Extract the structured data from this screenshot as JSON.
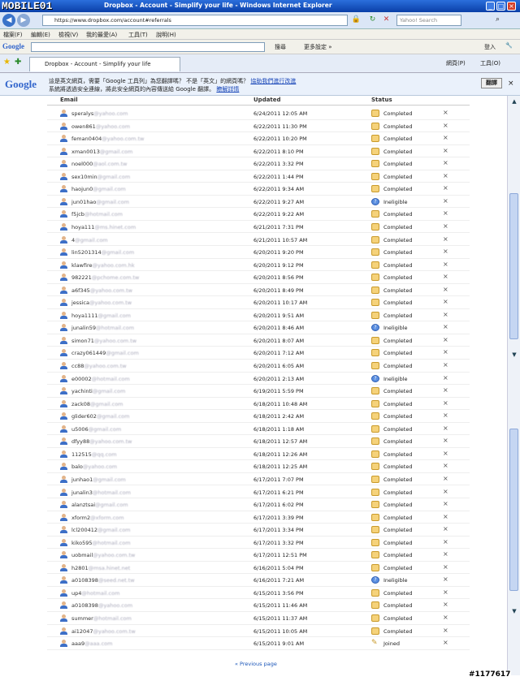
{
  "window": {
    "logo": "MOBILE01",
    "title": "Dropbox - Account - Simplify your life - Windows Internet Explorer",
    "address": "https://www.dropbox.com/account#referrals",
    "search_placeholder": "Yahoo! Search"
  },
  "menu": [
    "檔案(F)",
    "編輯(E)",
    "檢視(V)",
    "我的最愛(A)",
    "工具(T)",
    "說明(H)"
  ],
  "google_toolbar": {
    "logo": "Google",
    "search_label": "搜尋",
    "more_label": "更多設定 »",
    "login_label": "登入"
  },
  "favorites": {
    "tab_title": "Dropbox - Account - Simplify your life",
    "page_label": "網頁(P)",
    "tools_label": "工具(O)"
  },
  "translate_bar": {
    "logo": "Google",
    "message1": "這是英文網頁，需要「Google 工具列」為您翻譯嗎？ 不是「英文」的網頁嗎？",
    "report_link": "協助我們進行改進",
    "message2": "系統將透過安全連線，將此安全網頁的內容傳送給 Google 翻譯。",
    "learn_more": "瞭解詳情",
    "translate_button": "翻譯"
  },
  "table": {
    "headers": {
      "email": "Email",
      "updated": "Updated",
      "status": "Status"
    },
    "rows": [
      {
        "email": "speralys",
        "domain": "@yahoo.com",
        "updated": "6/24/2011 12:05 AM",
        "status": "Completed"
      },
      {
        "email": "owen861",
        "domain": "@yahoo.com",
        "updated": "6/22/2011 11:30 PM",
        "status": "Completed"
      },
      {
        "email": "feman0404",
        "domain": "@yahoo.com.tw",
        "updated": "6/22/2011 10:20 PM",
        "status": "Completed"
      },
      {
        "email": "xman0013",
        "domain": "@gmail.com",
        "updated": "6/22/2011 8:10 PM",
        "status": "Completed"
      },
      {
        "email": "noel000",
        "domain": "@aol.com.tw",
        "updated": "6/22/2011 3:32 PM",
        "status": "Completed"
      },
      {
        "email": "sex10min",
        "domain": "@gmail.com",
        "updated": "6/22/2011 1:44 PM",
        "status": "Completed"
      },
      {
        "email": "haojun0",
        "domain": "@gmail.com",
        "updated": "6/22/2011 9:34 AM",
        "status": "Completed"
      },
      {
        "email": "jun01hao",
        "domain": "@gmail.com",
        "updated": "6/22/2011 9:27 AM",
        "status": "Ineligible"
      },
      {
        "email": "f5jcb",
        "domain": "@hotmail.com",
        "updated": "6/22/2011 9:22 AM",
        "status": "Completed"
      },
      {
        "email": "hoya111",
        "domain": "@ms.hinet.com",
        "updated": "6/21/2011 7:31 PM",
        "status": "Completed"
      },
      {
        "email": "4",
        "domain": "@gmail.com",
        "updated": "6/21/2011 10:57 AM",
        "status": "Completed"
      },
      {
        "email": "lin5201314",
        "domain": "@gmail.com",
        "updated": "6/20/2011 9:20 PM",
        "status": "Completed"
      },
      {
        "email": "klawfire",
        "domain": "@yahoo.com.hk",
        "updated": "6/20/2011 9:12 PM",
        "status": "Completed"
      },
      {
        "email": "982221",
        "domain": "@pchome.com.tw",
        "updated": "6/20/2011 8:56 PM",
        "status": "Completed"
      },
      {
        "email": "a6f345",
        "domain": "@yahoo.com.tw",
        "updated": "6/20/2011 8:49 PM",
        "status": "Completed"
      },
      {
        "email": "jessica",
        "domain": "@yahoo.com.tw",
        "updated": "6/20/2011 10:17 AM",
        "status": "Completed"
      },
      {
        "email": "hoya1111",
        "domain": "@gmail.com",
        "updated": "6/20/2011 9:51 AM",
        "status": "Completed"
      },
      {
        "email": "junalin59",
        "domain": "@hotmail.com",
        "updated": "6/20/2011 8:46 AM",
        "status": "Ineligible"
      },
      {
        "email": "simon71",
        "domain": "@yahoo.com.tw",
        "updated": "6/20/2011 8:07 AM",
        "status": "Completed"
      },
      {
        "email": "crazy061449",
        "domain": "@gmail.com",
        "updated": "6/20/2011 7:12 AM",
        "status": "Completed"
      },
      {
        "email": "cc88",
        "domain": "@yahoo.com.tw",
        "updated": "6/20/2011 6:05 AM",
        "status": "Completed"
      },
      {
        "email": "e00002",
        "domain": "@hotmail.com",
        "updated": "6/20/2011 2:13 AM",
        "status": "Ineligible"
      },
      {
        "email": "yachinti",
        "domain": "@gmail.com",
        "updated": "6/19/2011 5:59 PM",
        "status": "Completed"
      },
      {
        "email": "zack08",
        "domain": "@gmail.com",
        "updated": "6/18/2011 10:48 AM",
        "status": "Completed"
      },
      {
        "email": "glider602",
        "domain": "@gmail.com",
        "updated": "6/18/2011 2:42 AM",
        "status": "Completed"
      },
      {
        "email": "u5006",
        "domain": "@gmail.com",
        "updated": "6/18/2011 1:18 AM",
        "status": "Completed"
      },
      {
        "email": "dfyy88",
        "domain": "@yahoo.com.tw",
        "updated": "6/18/2011 12:57 AM",
        "status": "Completed"
      },
      {
        "email": "112515",
        "domain": "@qq.com",
        "updated": "6/18/2011 12:26 AM",
        "status": "Completed"
      },
      {
        "email": "balo",
        "domain": "@yahoo.com",
        "updated": "6/18/2011 12:25 AM",
        "status": "Completed"
      },
      {
        "email": "junhao1",
        "domain": "@gmail.com",
        "updated": "6/17/2011 7:07 PM",
        "status": "Completed"
      },
      {
        "email": "junalin3",
        "domain": "@hotmail.com",
        "updated": "6/17/2011 6:21 PM",
        "status": "Completed"
      },
      {
        "email": "alanztsai",
        "domain": "@gmail.com",
        "updated": "6/17/2011 6:02 PM",
        "status": "Completed"
      },
      {
        "email": "xform2",
        "domain": "@xform.com",
        "updated": "6/17/2011 3:39 PM",
        "status": "Completed"
      },
      {
        "email": "lcl200412",
        "domain": "@gmail.com",
        "updated": "6/17/2011 3:34 PM",
        "status": "Completed"
      },
      {
        "email": "kiko595",
        "domain": "@hotmail.com",
        "updated": "6/17/2011 3:32 PM",
        "status": "Completed"
      },
      {
        "email": "uobmail",
        "domain": "@yahoo.com.tw",
        "updated": "6/17/2011 12:51 PM",
        "status": "Completed"
      },
      {
        "email": "h2801",
        "domain": "@msa.hinet.net",
        "updated": "6/16/2011 5:04 PM",
        "status": "Completed"
      },
      {
        "email": "a0108398",
        "domain": "@seed.net.tw",
        "updated": "6/16/2011 7:21 AM",
        "status": "Ineligible"
      },
      {
        "email": "up4",
        "domain": "@hotmail.com",
        "updated": "6/15/2011 3:56 PM",
        "status": "Completed"
      },
      {
        "email": "a0108398",
        "domain": "@yahoo.com",
        "updated": "6/15/2011 11:46 AM",
        "status": "Completed"
      },
      {
        "email": "summer",
        "domain": "@hotmail.com",
        "updated": "6/15/2011 11:37 AM",
        "status": "Completed"
      },
      {
        "email": "ai12047",
        "domain": "@yahoo.com.tw",
        "updated": "6/15/2011 10:05 AM",
        "status": "Completed"
      },
      {
        "email": "aaa9",
        "domain": "@aaa.com",
        "updated": "6/15/2011 9:01 AM",
        "status": "Joined"
      }
    ],
    "remove_symbol": "×"
  },
  "pagination": {
    "prev": "« Previous page"
  },
  "watermark": "#1177617"
}
